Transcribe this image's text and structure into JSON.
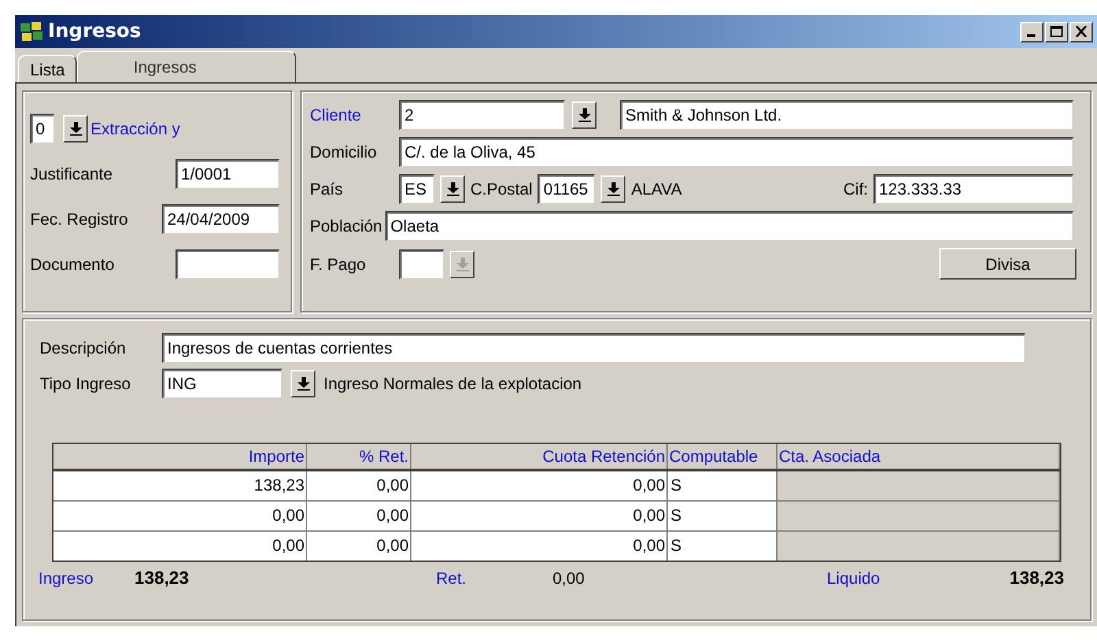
{
  "window": {
    "title": "Ingresos"
  },
  "tabs": [
    {
      "label": "Lista",
      "selected": false
    },
    {
      "label": "Ingresos",
      "selected": true
    }
  ],
  "left_group": {
    "series": {
      "value": "0",
      "label": "Extracción y"
    },
    "justificante": {
      "label": "Justificante",
      "value": "1/0001"
    },
    "fec_registro": {
      "label": "Fec. Registro",
      "value": "24/04/2009"
    },
    "documento": {
      "label": "Documento"
    }
  },
  "client_group": {
    "cliente": {
      "label": "Cliente",
      "value": "2",
      "name": "Smith & Johnson Ltd."
    },
    "domicilio": {
      "label": "Domicilio",
      "value": "C/. de la Oliva, 45"
    },
    "pais": {
      "label": "País",
      "value": "ES"
    },
    "postal": {
      "label": "C.Postal",
      "value": "01165",
      "province": "ALAVA"
    },
    "cif": {
      "label": "Cif:",
      "value": "123.333.33"
    },
    "poblacion": {
      "label": "Población",
      "value": "Olaeta"
    },
    "pago": {
      "label": "F. Pago",
      "disabled": true
    },
    "divisa_button": "Divisa"
  },
  "detail": {
    "descripcion": {
      "label": "Descripción",
      "value": "Ingresos de cuentas corrientes"
    },
    "tipo": {
      "label": "Tipo Ingreso",
      "value": "ING",
      "description": "Ingreso Normales de la explotacion"
    }
  },
  "table": {
    "columns": [
      {
        "label": "Importe",
        "disabled": false
      },
      {
        "label": "% Ret.",
        "disabled": false
      },
      {
        "label": "Cuota Retención",
        "disabled": false
      },
      {
        "label": "Computable",
        "disabled": false
      },
      {
        "label": "Cta. Asociada",
        "disabled": true
      }
    ],
    "rows": [
      [
        "138,23",
        "0,00",
        "0,00",
        "S",
        ""
      ],
      [
        "0,00",
        "0,00",
        "0,00",
        "S",
        ""
      ],
      [
        "0,00",
        "0,00",
        "0,00",
        "S",
        ""
      ]
    ]
  },
  "totals": {
    "ingreso": {
      "label": "Ingreso",
      "value": "138,23"
    },
    "ret": {
      "label": "Ret.",
      "value": "0,00"
    },
    "liquido": {
      "label": "Liquido",
      "value": "138,23"
    }
  }
}
